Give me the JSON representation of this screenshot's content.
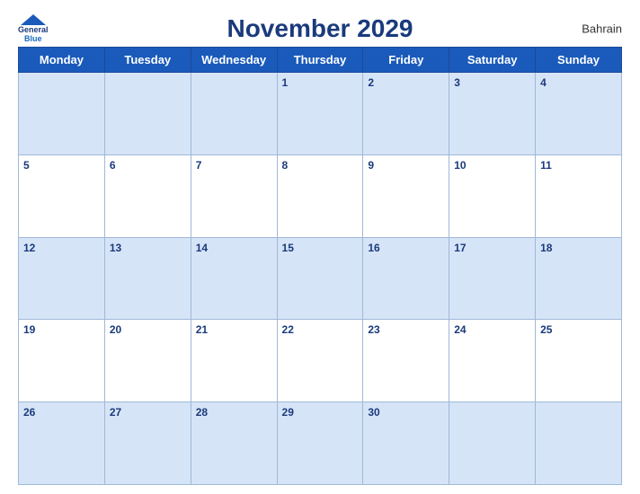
{
  "header": {
    "title": "November 2029",
    "country": "Bahrain",
    "logo": {
      "line1": "General",
      "line2": "Blue"
    }
  },
  "weekdays": [
    "Monday",
    "Tuesday",
    "Wednesday",
    "Thursday",
    "Friday",
    "Saturday",
    "Sunday"
  ],
  "weeks": [
    [
      null,
      null,
      null,
      1,
      2,
      3,
      4
    ],
    [
      5,
      6,
      7,
      8,
      9,
      10,
      11
    ],
    [
      12,
      13,
      14,
      15,
      16,
      17,
      18
    ],
    [
      19,
      20,
      21,
      22,
      23,
      24,
      25
    ],
    [
      26,
      27,
      28,
      29,
      30,
      null,
      null
    ]
  ]
}
